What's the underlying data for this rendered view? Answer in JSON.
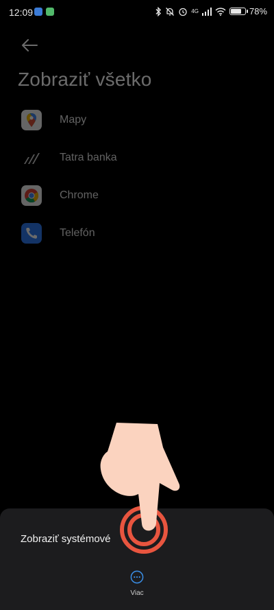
{
  "status_bar": {
    "time": "12:09",
    "network": "4G",
    "battery": "78",
    "battery_level": 0.78
  },
  "header": {
    "title": "Zobraziť všetko"
  },
  "apps": [
    {
      "label": "Mapy",
      "icon": "google-maps-icon"
    },
    {
      "label": "Tatra banka",
      "icon": "tatra-banka-icon"
    },
    {
      "label": "Chrome",
      "icon": "chrome-icon"
    },
    {
      "label": "Telefón",
      "icon": "phone-icon"
    }
  ],
  "sheet": {
    "item_label": "Zobraziť systémové",
    "more_label": "Viac",
    "accent_color": "#3a8ee6"
  },
  "colors": {
    "background": "#000000",
    "sheet_bg": "#1c1c1e",
    "gesture_ring": "#e8553f",
    "hand": "#fbd3bf"
  }
}
